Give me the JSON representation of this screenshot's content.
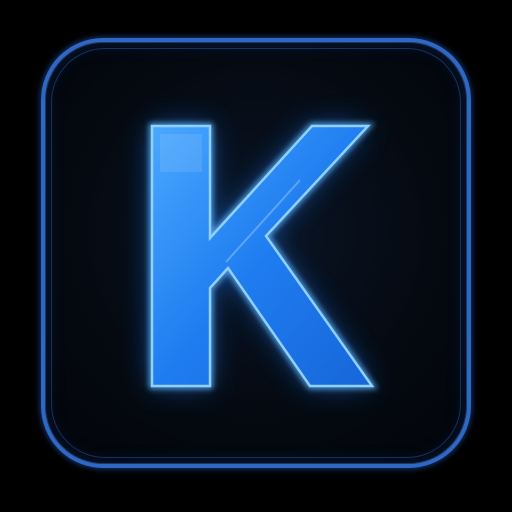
{
  "icon": {
    "name": "letter-k-app-icon",
    "letter": "K",
    "colors": {
      "background": "#000000",
      "tile_border": "#2f68c4",
      "tile_fill": "#050a12",
      "letter_fill": "#2a8cff",
      "letter_highlight": "#7cc4ff",
      "glow": "#1e7bff"
    }
  }
}
